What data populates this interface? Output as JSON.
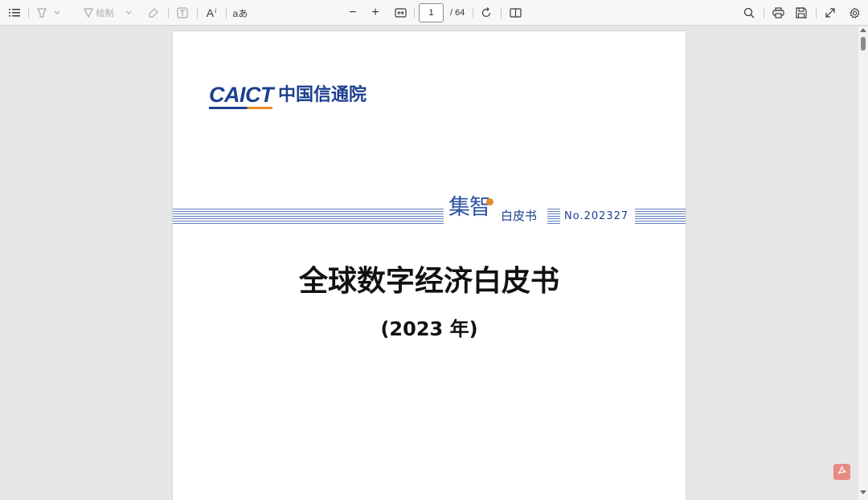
{
  "toolbar": {
    "outline_icon": "list-icon",
    "highlight_icon": "highlighter-icon",
    "draw_icon": "pen-icon",
    "draw_label": "绘制",
    "erase_icon": "eraser-icon",
    "text_icon": "text-box-icon",
    "read_aloud_label": "A",
    "translate_label": "aあ",
    "zoom_out_label": "−",
    "zoom_in_label": "+",
    "page_current": "1",
    "page_total": "/ 64",
    "search_icon": "search-icon",
    "print_icon": "print-icon",
    "save_icon": "save-icon",
    "fullscreen_icon": "expand-icon",
    "settings_icon": "gear-icon"
  },
  "document": {
    "logo_en": "CAICT",
    "logo_cn": "中国信通院",
    "banner_brand": "集智",
    "banner_sub": "白皮书",
    "banner_number": "No.202327",
    "title": "全球数字经济白皮书",
    "subtitle": "(2023 年)"
  },
  "colors": {
    "brand_blue": "#1c3f8f",
    "brand_orange": "#e8892a",
    "pdf_badge": "#e98a82"
  }
}
